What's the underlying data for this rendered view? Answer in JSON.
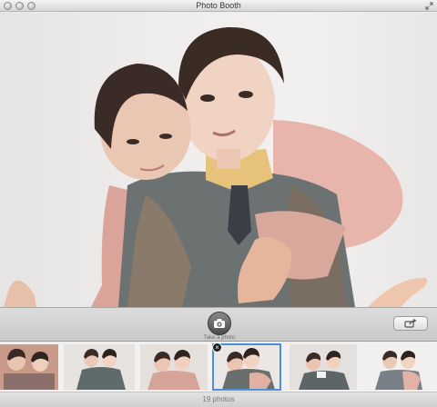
{
  "window": {
    "title": "Photo Booth"
  },
  "toolbar": {
    "shutter_label": "Take a photo",
    "shutter_icon": "camera-icon",
    "share_icon": "share-icon"
  },
  "strip": {
    "thumbnail_count_shown": 6,
    "selected_index": 3,
    "delete_icon": "close-icon"
  },
  "status": {
    "photo_count": "19 photos"
  }
}
